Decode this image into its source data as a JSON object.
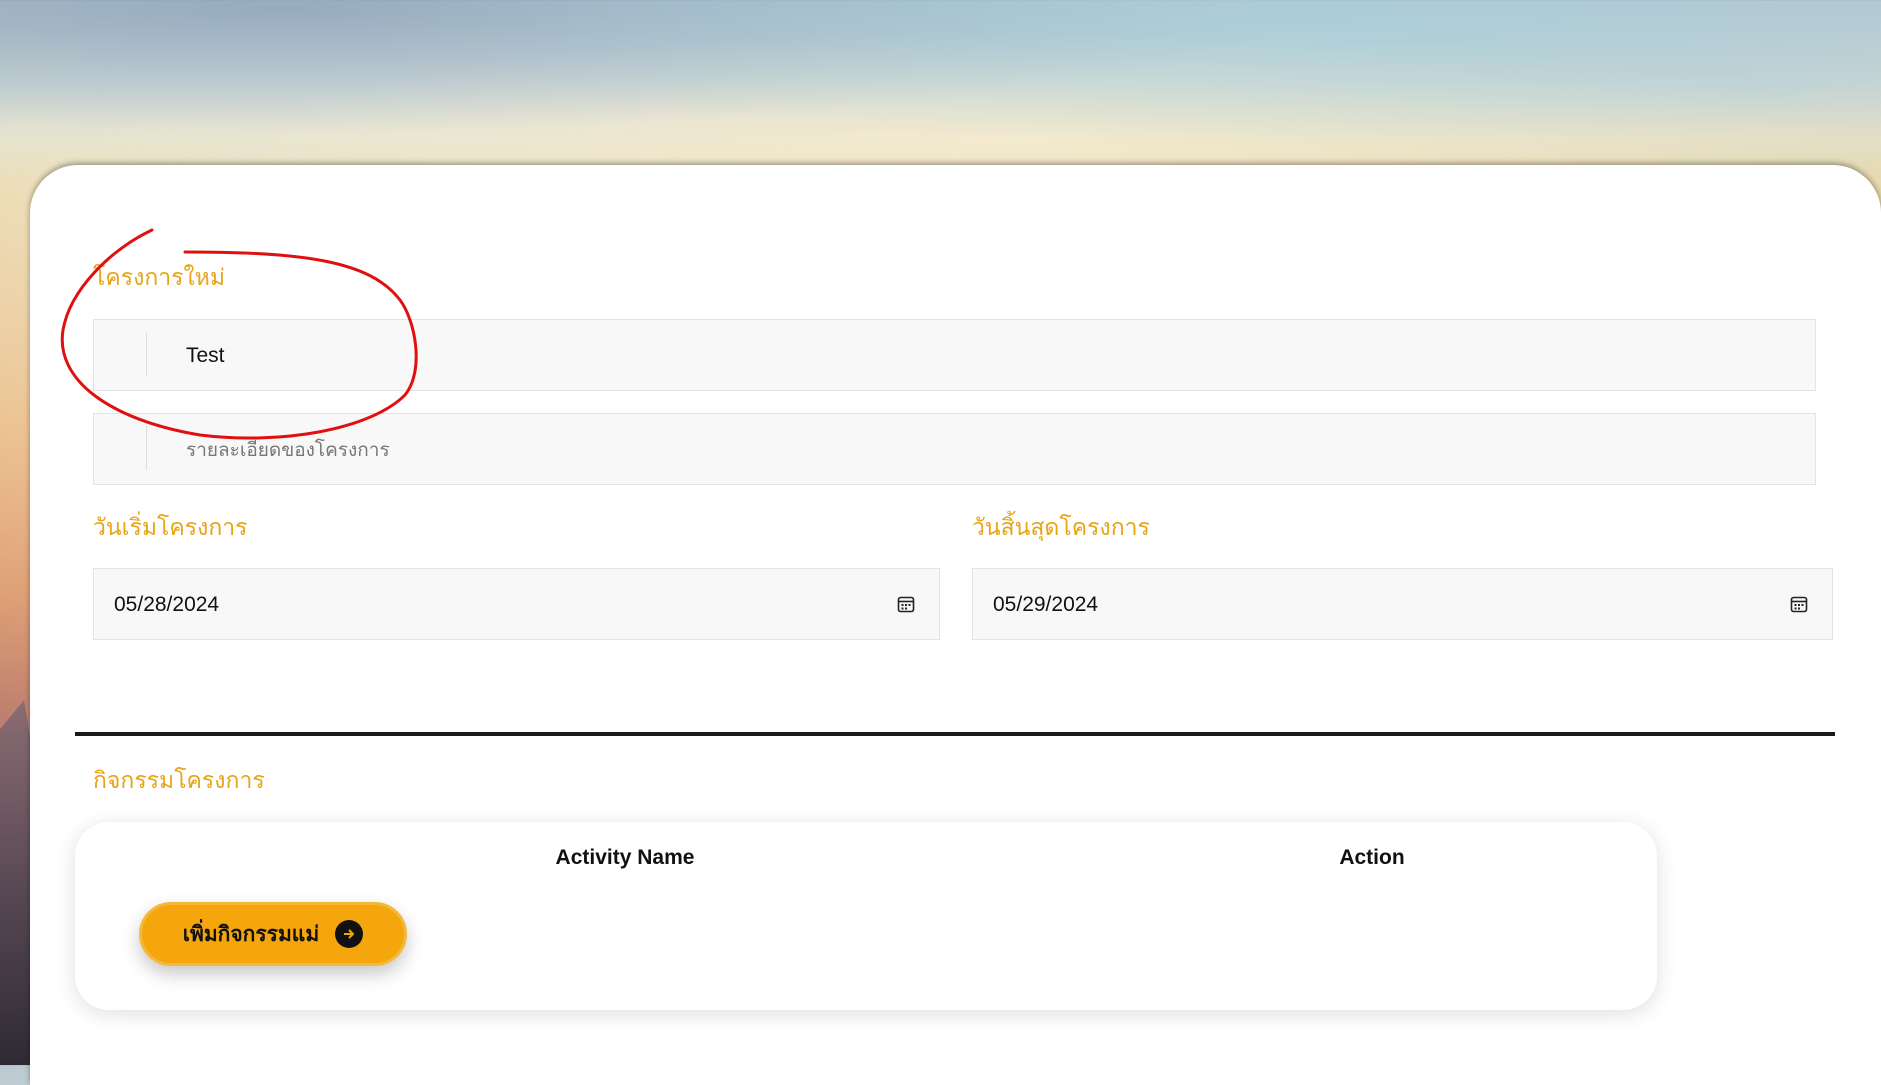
{
  "form": {
    "project_label": "โครงการใหม่",
    "project_name_value": "Test",
    "project_detail_placeholder": "รายละเอียดของโครงการ",
    "start_date_label": "วันเริ่มโครงการ",
    "start_date_value": "05/28/2024",
    "end_date_label": "วันสิ้นสุดโครงการ",
    "end_date_value": "05/29/2024"
  },
  "activities": {
    "section_label": "กิจกรรมโครงการ",
    "columns": [
      "Activity Name",
      "Action"
    ],
    "add_button_label": "เพิ่มกิจกรรมแม่"
  },
  "colors": {
    "accent": "#e8a413",
    "button": "#f5a60c",
    "annotation": "#e01010"
  },
  "icons": {
    "date_picker": "calendar-icon",
    "button_arrow": "arrow-right-circle-icon"
  }
}
